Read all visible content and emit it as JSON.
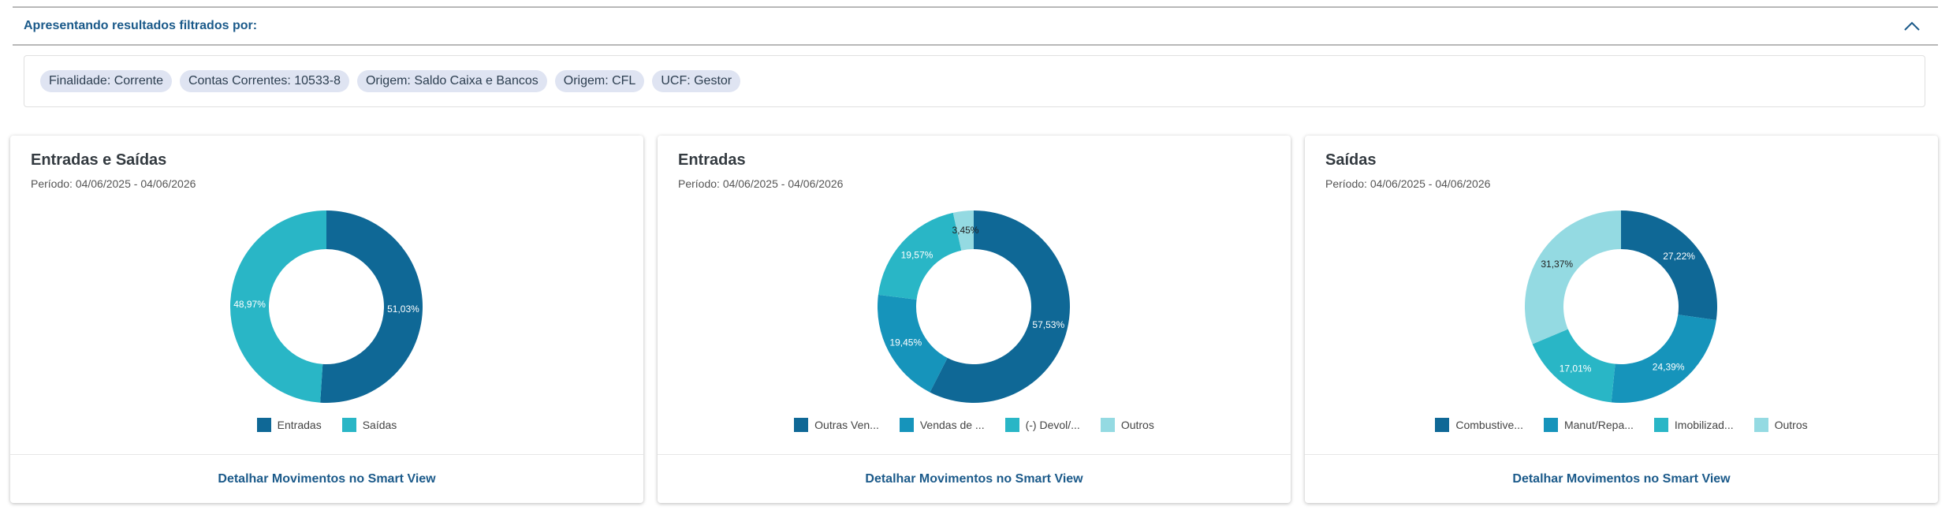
{
  "filter": {
    "title": "Apresentando resultados filtrados por:",
    "chips": [
      "Finalidade: Corrente",
      "Contas Correntes: 10533-8",
      "Origem: Saldo Caixa e Bancos",
      "Origem: CFL",
      "UCF: Gestor"
    ]
  },
  "cards": [
    {
      "title": "Entradas e Saídas",
      "period": "Período: 04/06/2025 - 04/06/2026",
      "link": "Detalhar Movimentos no Smart View",
      "slices": [
        {
          "label": "Entradas",
          "value": 51.03,
          "text": "51,03%",
          "color": "#0f6896"
        },
        {
          "label": "Saídas",
          "value": 48.97,
          "text": "48,97%",
          "color": "#29b6c6"
        }
      ]
    },
    {
      "title": "Entradas",
      "period": "Período: 04/06/2025 - 04/06/2026",
      "link": "Detalhar Movimentos no Smart View",
      "slices": [
        {
          "label": "Outras Ven...",
          "value": 57.53,
          "text": "57,53%",
          "color": "#0f6896"
        },
        {
          "label": "Vendas de ...",
          "value": 19.45,
          "text": "19,45%",
          "color": "#1694bb"
        },
        {
          "label": "(-) Devol/...",
          "value": 19.57,
          "text": "19,57%",
          "color": "#29b6c6"
        },
        {
          "label": "Outros",
          "value": 3.45,
          "text": "3,45%",
          "color": "#94dae2"
        }
      ]
    },
    {
      "title": "Saídas",
      "period": "Período: 04/06/2025 - 04/06/2026",
      "link": "Detalhar Movimentos no Smart View",
      "slices": [
        {
          "label": "Combustive...",
          "value": 27.22,
          "text": "27,22%",
          "color": "#0f6896"
        },
        {
          "label": "Manut/Repa...",
          "value": 24.39,
          "text": "24,39%",
          "color": "#1694bb"
        },
        {
          "label": "Imobilizad...",
          "value": 17.01,
          "text": "17,01%",
          "color": "#29b6c6"
        },
        {
          "label": "Outros",
          "value": 31.37,
          "text": "31,37%",
          "color": "#94dae2"
        }
      ]
    }
  ]
}
